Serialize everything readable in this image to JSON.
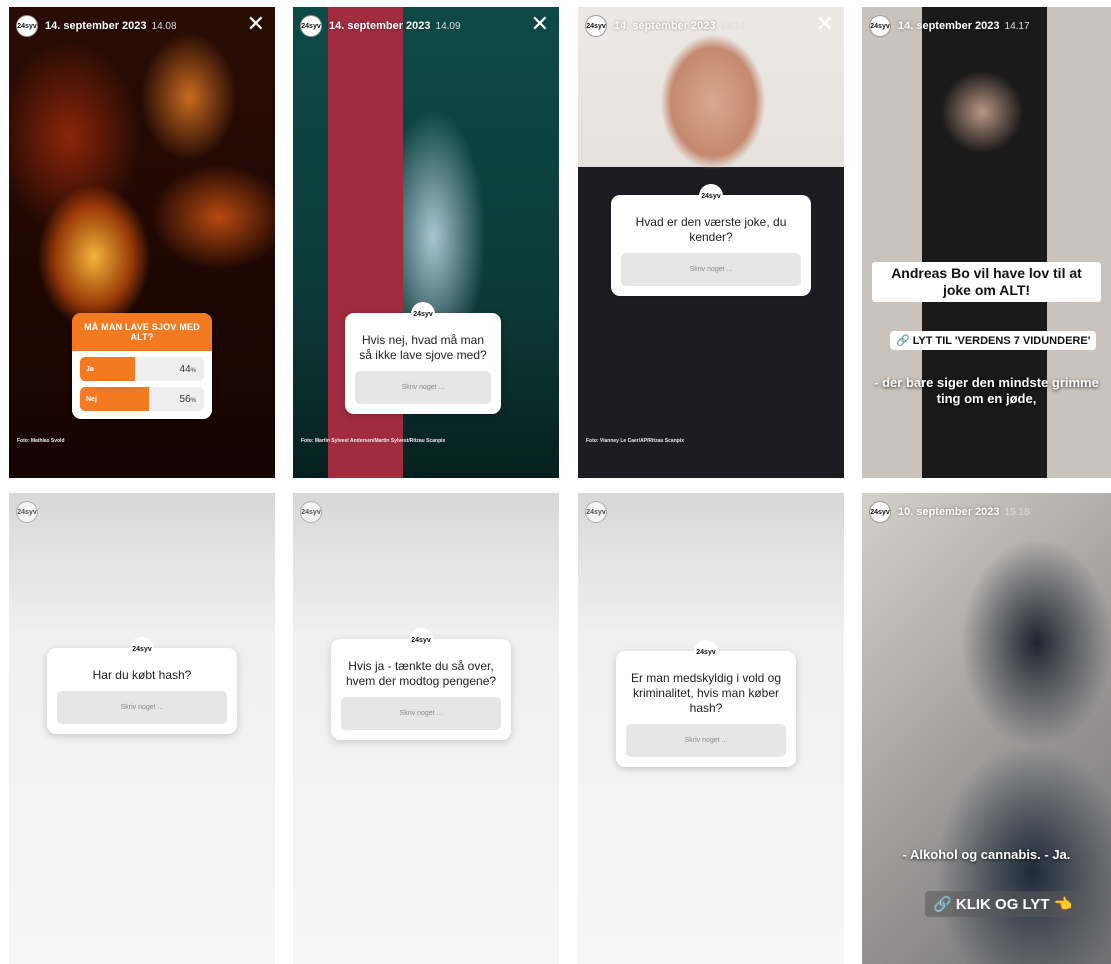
{
  "stories": [
    {
      "avatar": "24syv",
      "date": "14. september 2023",
      "time": "14.08",
      "credit": "Foto: Mathias Svold",
      "poll": {
        "question": "MÅ MAN LAVE SJOV MED ALT?",
        "options": [
          {
            "label": "Ja",
            "percent": 44
          },
          {
            "label": "Nej",
            "percent": 56
          }
        ],
        "percent_suffix": "%"
      }
    },
    {
      "avatar": "24syv",
      "date": "14. september 2023",
      "time": "14.09",
      "credit": "Foto: Martin Sylvest Andersen/Martin Sylvest/Ritzau Scanpix",
      "question": "Hvis nej, hvad må man så ikke lave sjove med?",
      "placeholder": "Skriv noget ..."
    },
    {
      "avatar": "24syv",
      "date": "14. september 2023",
      "time": "14.14",
      "credit": "Foto: Vianney Le Caer/AP/Ritzau Scanpix",
      "question": "Hvad er den værste joke, du kender?",
      "placeholder": "Skriv noget ..."
    },
    {
      "avatar": "24syv",
      "date": "14. september 2023",
      "time": "14.17",
      "title": "Andreas Bo vil have lov til at joke om ALT!",
      "link_label": "LYT TIL 'VERDENS 7 VIDUNDERE'",
      "subtitle": "- der bare siger den mindste grimme ting om en jøde,"
    },
    {
      "avatar": "24syv",
      "question": "Har du købt hash?",
      "placeholder": "Skriv noget ..."
    },
    {
      "avatar": "24syv",
      "question": "Hvis ja - tænkte du så over, hvem der modtog pengene?",
      "placeholder": "Skriv noget ..."
    },
    {
      "avatar": "24syv",
      "question": "Er man medskyldig i vold og kriminalitet, hvis man køber hash?",
      "placeholder": "Skriv noget ..."
    },
    {
      "avatar": "24syv",
      "date": "10. september 2023",
      "time": "15.18",
      "subtitle": "- Alkohol og cannabis. - Ja.",
      "link_label": "KLIK OG LYT"
    }
  ],
  "icons": {
    "close": "close-icon",
    "link": "link-icon",
    "pointing_hand": "pointing-hand-icon"
  },
  "colors": {
    "poll_orange": "#f47a22",
    "link_red": "#dd2233"
  }
}
